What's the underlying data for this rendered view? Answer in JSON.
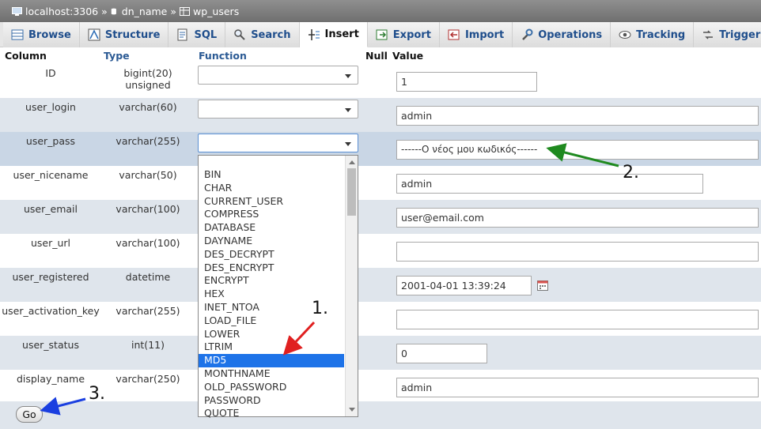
{
  "breadcrumb": {
    "server": "localhost:3306",
    "db": "dn_name",
    "table": "wp_users",
    "sep": "»"
  },
  "tabs": [
    {
      "label": "Browse",
      "icon": "browse-icon"
    },
    {
      "label": "Structure",
      "icon": "structure-icon"
    },
    {
      "label": "SQL",
      "icon": "sql-icon"
    },
    {
      "label": "Search",
      "icon": "search-icon"
    },
    {
      "label": "Insert",
      "icon": "insert-icon",
      "active": true
    },
    {
      "label": "Export",
      "icon": "export-icon"
    },
    {
      "label": "Import",
      "icon": "import-icon"
    },
    {
      "label": "Operations",
      "icon": "operations-icon"
    },
    {
      "label": "Tracking",
      "icon": "tracking-icon"
    },
    {
      "label": "Triggers",
      "icon": "triggers-icon"
    }
  ],
  "headers": {
    "column": "Column",
    "type": "Type",
    "function": "Function",
    "null": "Null",
    "value": "Value"
  },
  "rows": [
    {
      "column": "ID",
      "type": "bigint(20) unsigned",
      "value": "1"
    },
    {
      "column": "user_login",
      "type": "varchar(60)",
      "value": "admin"
    },
    {
      "column": "user_pass",
      "type": "varchar(255)",
      "value": "------Ο νέος μου κωδικός------"
    },
    {
      "column": "user_nicename",
      "type": "varchar(50)",
      "value": "admin"
    },
    {
      "column": "user_email",
      "type": "varchar(100)",
      "value": "user@email.com"
    },
    {
      "column": "user_url",
      "type": "varchar(100)",
      "value": ""
    },
    {
      "column": "user_registered",
      "type": "datetime",
      "value": "2001-04-01 13:39:24"
    },
    {
      "column": "user_activation_key",
      "type": "varchar(255)",
      "value": ""
    },
    {
      "column": "user_status",
      "type": "int(11)",
      "value": "0"
    },
    {
      "column": "display_name",
      "type": "varchar(250)",
      "value": "admin"
    }
  ],
  "function_options": [
    "BIN",
    "CHAR",
    "CURRENT_USER",
    "COMPRESS",
    "DATABASE",
    "DAYNAME",
    "DES_DECRYPT",
    "DES_ENCRYPT",
    "ENCRYPT",
    "HEX",
    "INET_NTOA",
    "LOAD_FILE",
    "LOWER",
    "LTRIM",
    "MD5",
    "MONTHNAME",
    "OLD_PASSWORD",
    "PASSWORD",
    "QUOTE"
  ],
  "selected_function": "MD5",
  "go_label": "Go",
  "annotations": {
    "a1": "1.",
    "a2": "2.",
    "a3": "3."
  },
  "colors": {
    "tab_link": "#1f4e8c",
    "highlight_row": "#c9d6e5",
    "selected_option": "#1e73e8",
    "arrow1": "#e02020",
    "arrow2": "#1f8a1f",
    "arrow3": "#1a3fe0"
  }
}
